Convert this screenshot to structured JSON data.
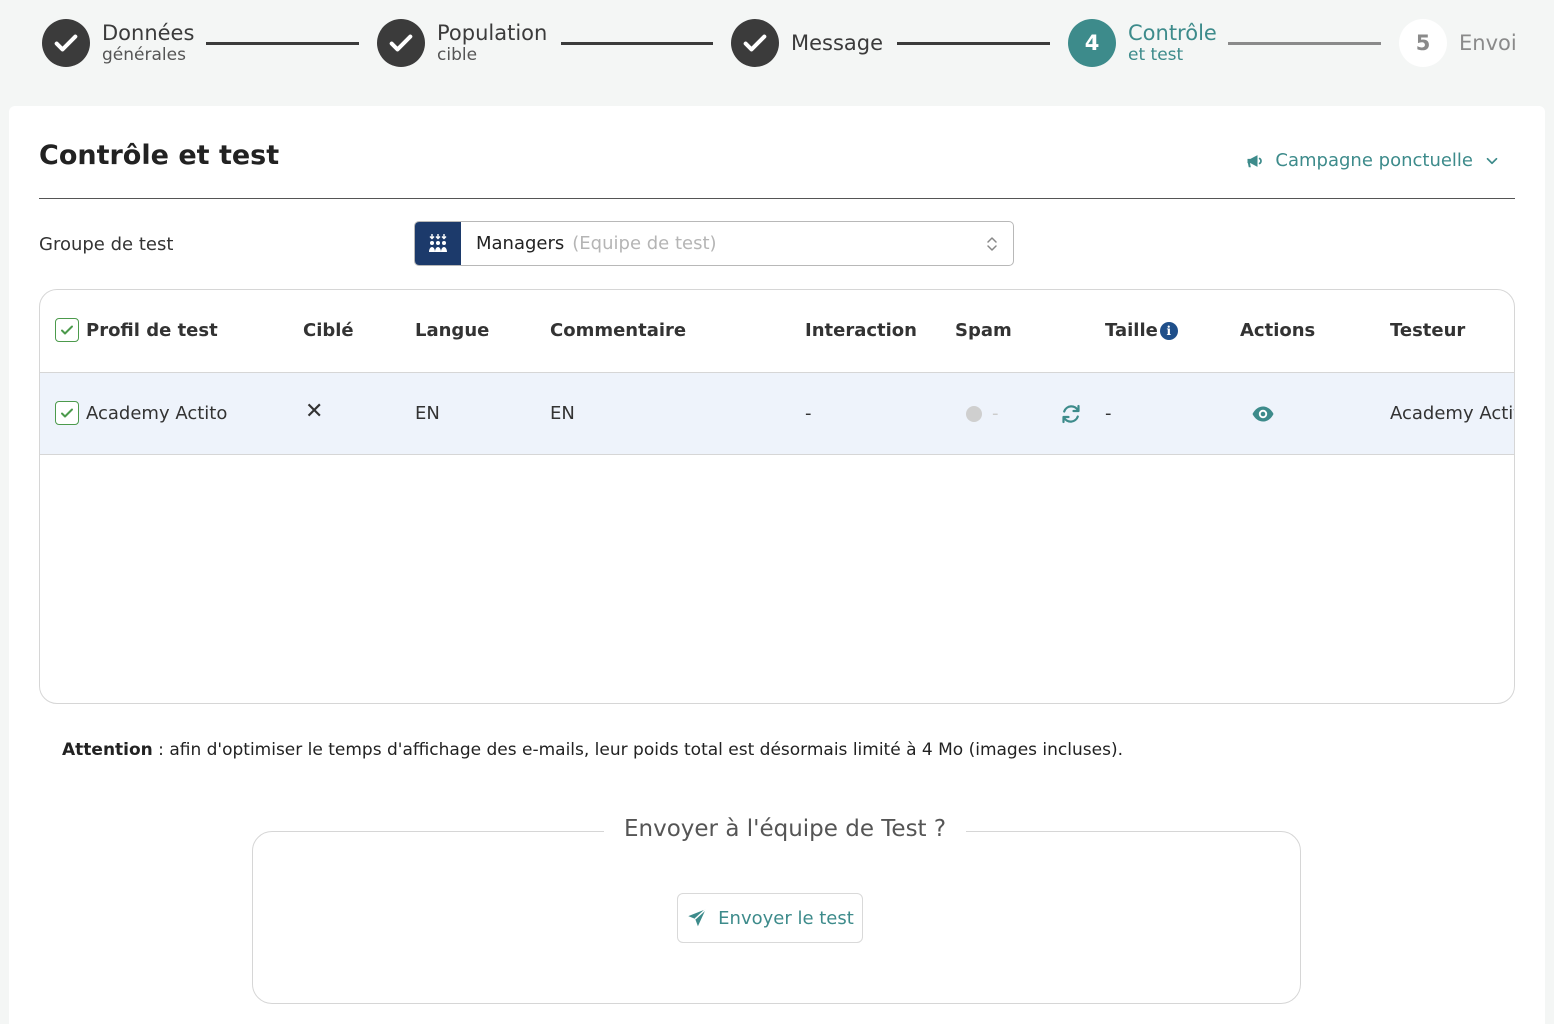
{
  "stepper": {
    "steps": [
      {
        "label": "Données",
        "sub": "générales"
      },
      {
        "label": "Population",
        "sub": "cible"
      },
      {
        "label": "Message",
        "sub": ""
      },
      {
        "number": "4",
        "label": "Contrôle",
        "sub": "et test"
      },
      {
        "number": "5",
        "label": "Envoi",
        "sub": ""
      }
    ]
  },
  "page": {
    "title": "Contrôle et test",
    "campaign_type": "Campagne ponctuelle"
  },
  "test_group": {
    "label": "Groupe de test",
    "value": "Managers",
    "hint": "(Equipe de test)"
  },
  "table": {
    "headers": [
      "Profil de test",
      "Ciblé",
      "Langue",
      "Commentaire",
      "Interaction",
      "Spam",
      "Taille",
      "Actions",
      "Testeur"
    ],
    "rows": [
      {
        "profile": "Academy Actito",
        "targeted": "✕",
        "language": "EN",
        "comment": "EN",
        "interaction": "-",
        "spam": "-",
        "size": "-",
        "tester": "Academy Actito"
      }
    ]
  },
  "attention": {
    "label": "Attention",
    "text": " : afin d'optimiser le temps d'affichage des e-mails, leur poids total est désormais limité à 4 Mo (images incluses)."
  },
  "send": {
    "legend": "Envoyer à l'équipe de Test ?",
    "button_label": "Envoyer le test"
  },
  "colors": {
    "accent": "#3d8b8b",
    "done": "#3b3b3b",
    "group_icon_bg": "#1c3a6b",
    "row_highlight": "#eef3fb",
    "checkbox": "#4c9a4c"
  }
}
